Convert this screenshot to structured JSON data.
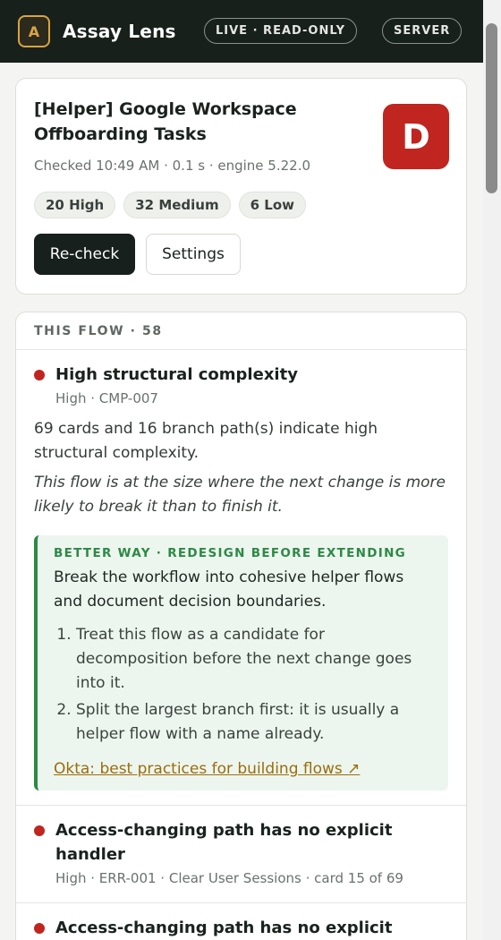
{
  "app": {
    "logo_letter": "A",
    "title": "Assay Lens",
    "mode_pill": "LIVE · READ-ONLY",
    "server_pill": "SERVER"
  },
  "summary": {
    "title": "[Helper] Google Workspace Offboarding Tasks",
    "grade": "D",
    "meta": "Checked 10:49 AM · 0.1 s · engine 5.22.0",
    "counts": [
      "20 High",
      "32 Medium",
      "6 Low"
    ],
    "recheck_label": "Re-check",
    "settings_label": "Settings"
  },
  "issues": {
    "section_label": "THIS FLOW · 58",
    "items": [
      {
        "title": "High structural complexity",
        "meta": "High · CMP-007",
        "description": "69 cards and 16 branch path(s) indicate high structural complexity.",
        "note": "This flow is at the size where the next change is more likely to break it than to finish it.",
        "better_way": {
          "label": "BETTER WAY · REDESIGN BEFORE EXTENDING",
          "text": "Break the workflow into cohesive helper flows and document decision boundaries.",
          "steps": [
            "Treat this flow as a candidate for decomposition before the next change goes into it.",
            "Split the largest branch first: it is usually a helper flow with a name already."
          ],
          "link": "Okta: best practices for building flows ↗"
        }
      },
      {
        "title": "Access-changing path has no explicit handler",
        "meta": "High · ERR-001 · Clear User Sessions · card 15 of 69"
      },
      {
        "title": "Access-changing path has no explicit handler",
        "meta": ""
      }
    ]
  },
  "colors": {
    "topbar": "#18201c",
    "accent": "#d9a441",
    "grade_bg": "#c0251f",
    "high_dot": "#c0251f",
    "better_green": "#2b8a45",
    "link": "#9a6d0e"
  }
}
